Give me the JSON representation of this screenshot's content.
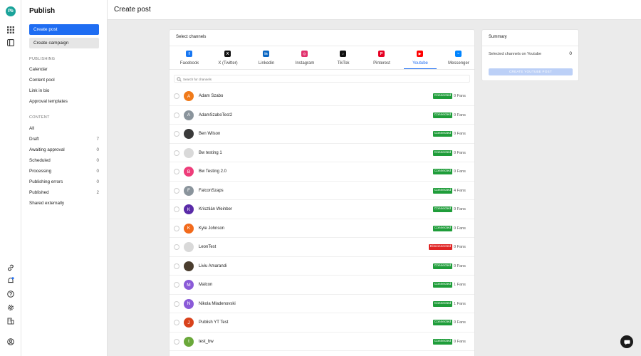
{
  "app": {
    "logo": "Pb",
    "title": "Publish"
  },
  "rail": {
    "icons": [
      "grid-icon",
      "panel-icon",
      "link-icon",
      "bell-icon",
      "help-icon",
      "gear-icon",
      "building-icon",
      "account-icon"
    ],
    "notification_color": "#1f6df2"
  },
  "nav": {
    "create_post": "Create post",
    "create_campaign": "Create campaign",
    "publishing_header": "PUBLISHING",
    "publishing_items": [
      "Calendar",
      "Content pool",
      "Link in bio",
      "Approval templates"
    ],
    "content_header": "CONTENT",
    "content_items": [
      {
        "label": "All",
        "count": ""
      },
      {
        "label": "Draft",
        "count": "7"
      },
      {
        "label": "Awaiting approval",
        "count": "0"
      },
      {
        "label": "Scheduled",
        "count": "0"
      },
      {
        "label": "Processing",
        "count": "0"
      },
      {
        "label": "Publishing errors",
        "count": "0"
      },
      {
        "label": "Published",
        "count": "2"
      },
      {
        "label": "Shared externally",
        "count": ""
      }
    ]
  },
  "header": {
    "title": "Create post"
  },
  "channels": {
    "title": "Select channels",
    "tabs": [
      {
        "label": "Facebook",
        "icon": "facebook-icon",
        "glyph": "f",
        "color": "#1877f2"
      },
      {
        "label": "X (Twitter)",
        "icon": "x-icon",
        "glyph": "X",
        "color": "#111111"
      },
      {
        "label": "Linkedin",
        "icon": "linkedin-icon",
        "glyph": "in",
        "color": "#0a66c2"
      },
      {
        "label": "Instagram",
        "icon": "instagram-icon",
        "glyph": "◎",
        "color": "#e1306c"
      },
      {
        "label": "TikTok",
        "icon": "tiktok-icon",
        "glyph": "♪",
        "color": "#111111"
      },
      {
        "label": "Pinterest",
        "icon": "pinterest-icon",
        "glyph": "P",
        "color": "#e60023"
      },
      {
        "label": "Youtube",
        "icon": "youtube-icon",
        "glyph": "▶",
        "color": "#ff0000"
      },
      {
        "label": "Messenger",
        "icon": "messenger-icon",
        "glyph": "~",
        "color": "#0084ff"
      }
    ],
    "active_tab": "Youtube",
    "search_placeholder": "Search for channels",
    "rows": [
      {
        "name": "Adam Szabo",
        "initial": "A",
        "avatar_color": "#f07a1a",
        "status": "Connected",
        "fans": "0 Fans"
      },
      {
        "name": "AdamSzaboTest2",
        "initial": "A",
        "avatar_color": "#8a949c",
        "status": "Connected",
        "fans": "0 Fans"
      },
      {
        "name": "Ben Wilson",
        "initial": "",
        "avatar_color": "#3a3a3a",
        "status": "Connected",
        "fans": "0 Fans"
      },
      {
        "name": "Bw testing 1",
        "initial": "",
        "avatar_color": "#d9d9d9",
        "status": "Connected",
        "fans": "0 Fans"
      },
      {
        "name": "Bw Testing 2.0",
        "initial": "B",
        "avatar_color": "#ee3d7a",
        "status": "Connected",
        "fans": "0 Fans"
      },
      {
        "name": "FalconSzaps",
        "initial": "F",
        "avatar_color": "#8a949c",
        "status": "Connected",
        "fans": "4 Fans"
      },
      {
        "name": "Krisztián Weinber",
        "initial": "K",
        "avatar_color": "#5a2ba8",
        "status": "Connected",
        "fans": "0 Fans"
      },
      {
        "name": "Kyle Johnson",
        "initial": "K",
        "avatar_color": "#f26a1b",
        "status": "Connected",
        "fans": "0 Fans"
      },
      {
        "name": "LeonTest",
        "initial": "",
        "avatar_color": "#d9d9d9",
        "status": "Disconnected",
        "fans": "0 Fans"
      },
      {
        "name": "Liviu Amarandi",
        "initial": "",
        "avatar_color": "#4a3d2e",
        "status": "Connected",
        "fans": "0 Fans"
      },
      {
        "name": "Malcon",
        "initial": "M",
        "avatar_color": "#8a5ad8",
        "status": "Connected",
        "fans": "1 Fans"
      },
      {
        "name": "Nikola Mladenovski",
        "initial": "N",
        "avatar_color": "#8a5ad8",
        "status": "Connected",
        "fans": "1 Fans"
      },
      {
        "name": "Publish YT Test",
        "initial": "J",
        "avatar_color": "#d9421b",
        "status": "Connected",
        "fans": "0 Fans"
      },
      {
        "name": "test_bw",
        "initial": "t",
        "avatar_color": "#6aa83a",
        "status": "Connected",
        "fans": "0 Fans"
      }
    ],
    "colors": {
      "connected": "#1f9d3a",
      "disconnected": "#e02424",
      "accent": "#1f6df2"
    }
  },
  "summary": {
    "title": "Summary",
    "label": "Selected channels on Youtube",
    "count": "0",
    "button": "CREATE YOUTUBE POST"
  }
}
